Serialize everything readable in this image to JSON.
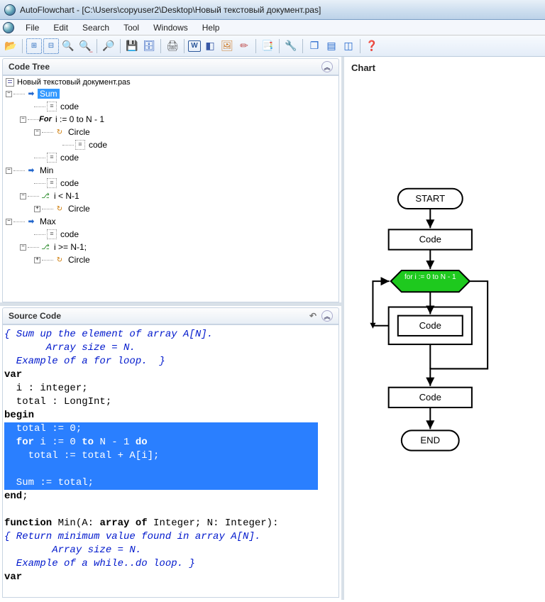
{
  "title": "AutoFlowchart - [C:\\Users\\copyuser2\\Desktop\\Новый текстовый документ.pas]",
  "menu": {
    "items": [
      "File",
      "Edit",
      "Search",
      "Tool",
      "Windows",
      "Help"
    ]
  },
  "panels": {
    "codeTree": "Code Tree",
    "sourceCode": "Source Code",
    "chart": "Chart"
  },
  "tree": {
    "root": "Новый текстовый документ.pas",
    "n_sum": "Sum",
    "n_code": "code",
    "n_for": "i := 0 to N - 1",
    "n_for_prefix": "For  ",
    "n_circle": "Circle",
    "n_min": "Min",
    "n_ilt": "i < N-1",
    "n_max": "Max",
    "n_ige": "i >= N-1;"
  },
  "source": {
    "l1": "{ Sum up the element of array A[N].",
    "l2": "       Array size = N.",
    "l3": "  Example of a for loop.  }",
    "l4a": "var",
    "l5": "  i : integer;",
    "l6": "  total : LongInt;",
    "l7a": "begin",
    "s1": "  total := 0;",
    "s2a": "  for",
    "s2b": " i := 0 ",
    "s2c": "to",
    "s2d": " N - 1 ",
    "s2e": "do",
    "s3": "    total := total + A[i];",
    "s4": "",
    "s5": "  Sum := total;",
    "l12a": "end",
    "l12b": ";",
    "l13": "",
    "l14a": "function",
    "l14b": " Min(A: ",
    "l14c": "array of",
    "l14d": " Integer; N: Integer):",
    "l15": "{ Return minimum value found in array A[N].",
    "l16": "        Array size = N.",
    "l17": "  Example of a while..do loop. }",
    "l18a": "var"
  },
  "chart": {
    "start": "START",
    "code1": "Code",
    "loop": "for i := 0 to N - 1",
    "code2": "Code",
    "code3": "Code",
    "end": "END"
  }
}
